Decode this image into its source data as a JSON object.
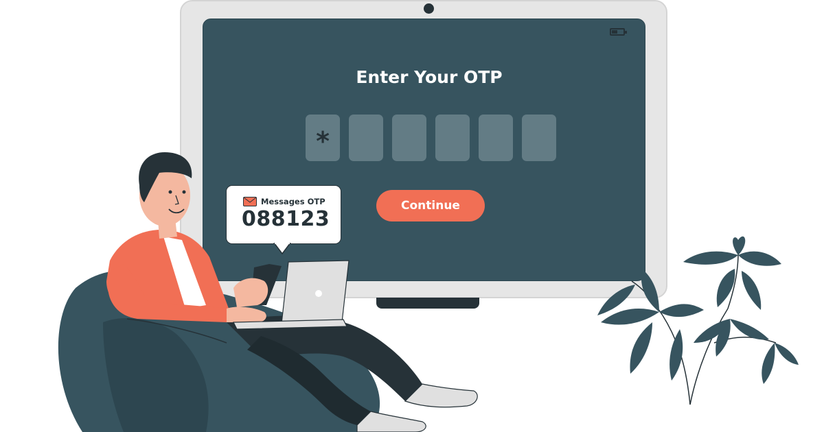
{
  "screen": {
    "title": "Enter Your OTP",
    "otp_digits": [
      "*",
      "",
      "",
      "",
      "",
      ""
    ],
    "continue_label": "Continue"
  },
  "message": {
    "label": "Messages OTP",
    "code": "088123"
  },
  "colors": {
    "screen_bg": "#37545f",
    "otp_box": "#637c85",
    "accent": "#f16f55",
    "dark": "#263238",
    "frame": "#e6e6e6"
  },
  "icons": {
    "camera": "camera-icon",
    "battery": "battery-icon",
    "message": "envelope-icon"
  }
}
